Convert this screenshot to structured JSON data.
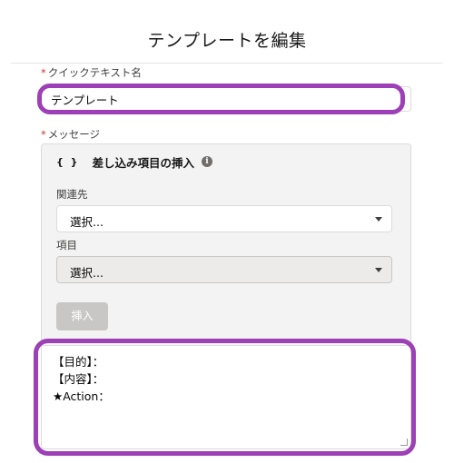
{
  "modal": {
    "title": "テンプレートを編集"
  },
  "quick_text_name": {
    "required_mark": "*",
    "label": "クイックテキスト名",
    "value": "テンプレート"
  },
  "message": {
    "required_mark": "*",
    "label": "メッセージ",
    "merge_field": {
      "braces_icon": "{ }",
      "header": "差し込み項目の挿入",
      "info_icon": "i",
      "related_to_label": "関連先",
      "related_to_value": "選択...",
      "field_label": "項目",
      "field_value": "選択...",
      "insert_label": "挿入"
    },
    "body_lines": [
      "【目的】：",
      "【内容】：",
      "★Action："
    ]
  },
  "colors": {
    "highlight": "#9d3fb6",
    "required": "#c23934",
    "disabled_button": "#c9c7c5"
  }
}
